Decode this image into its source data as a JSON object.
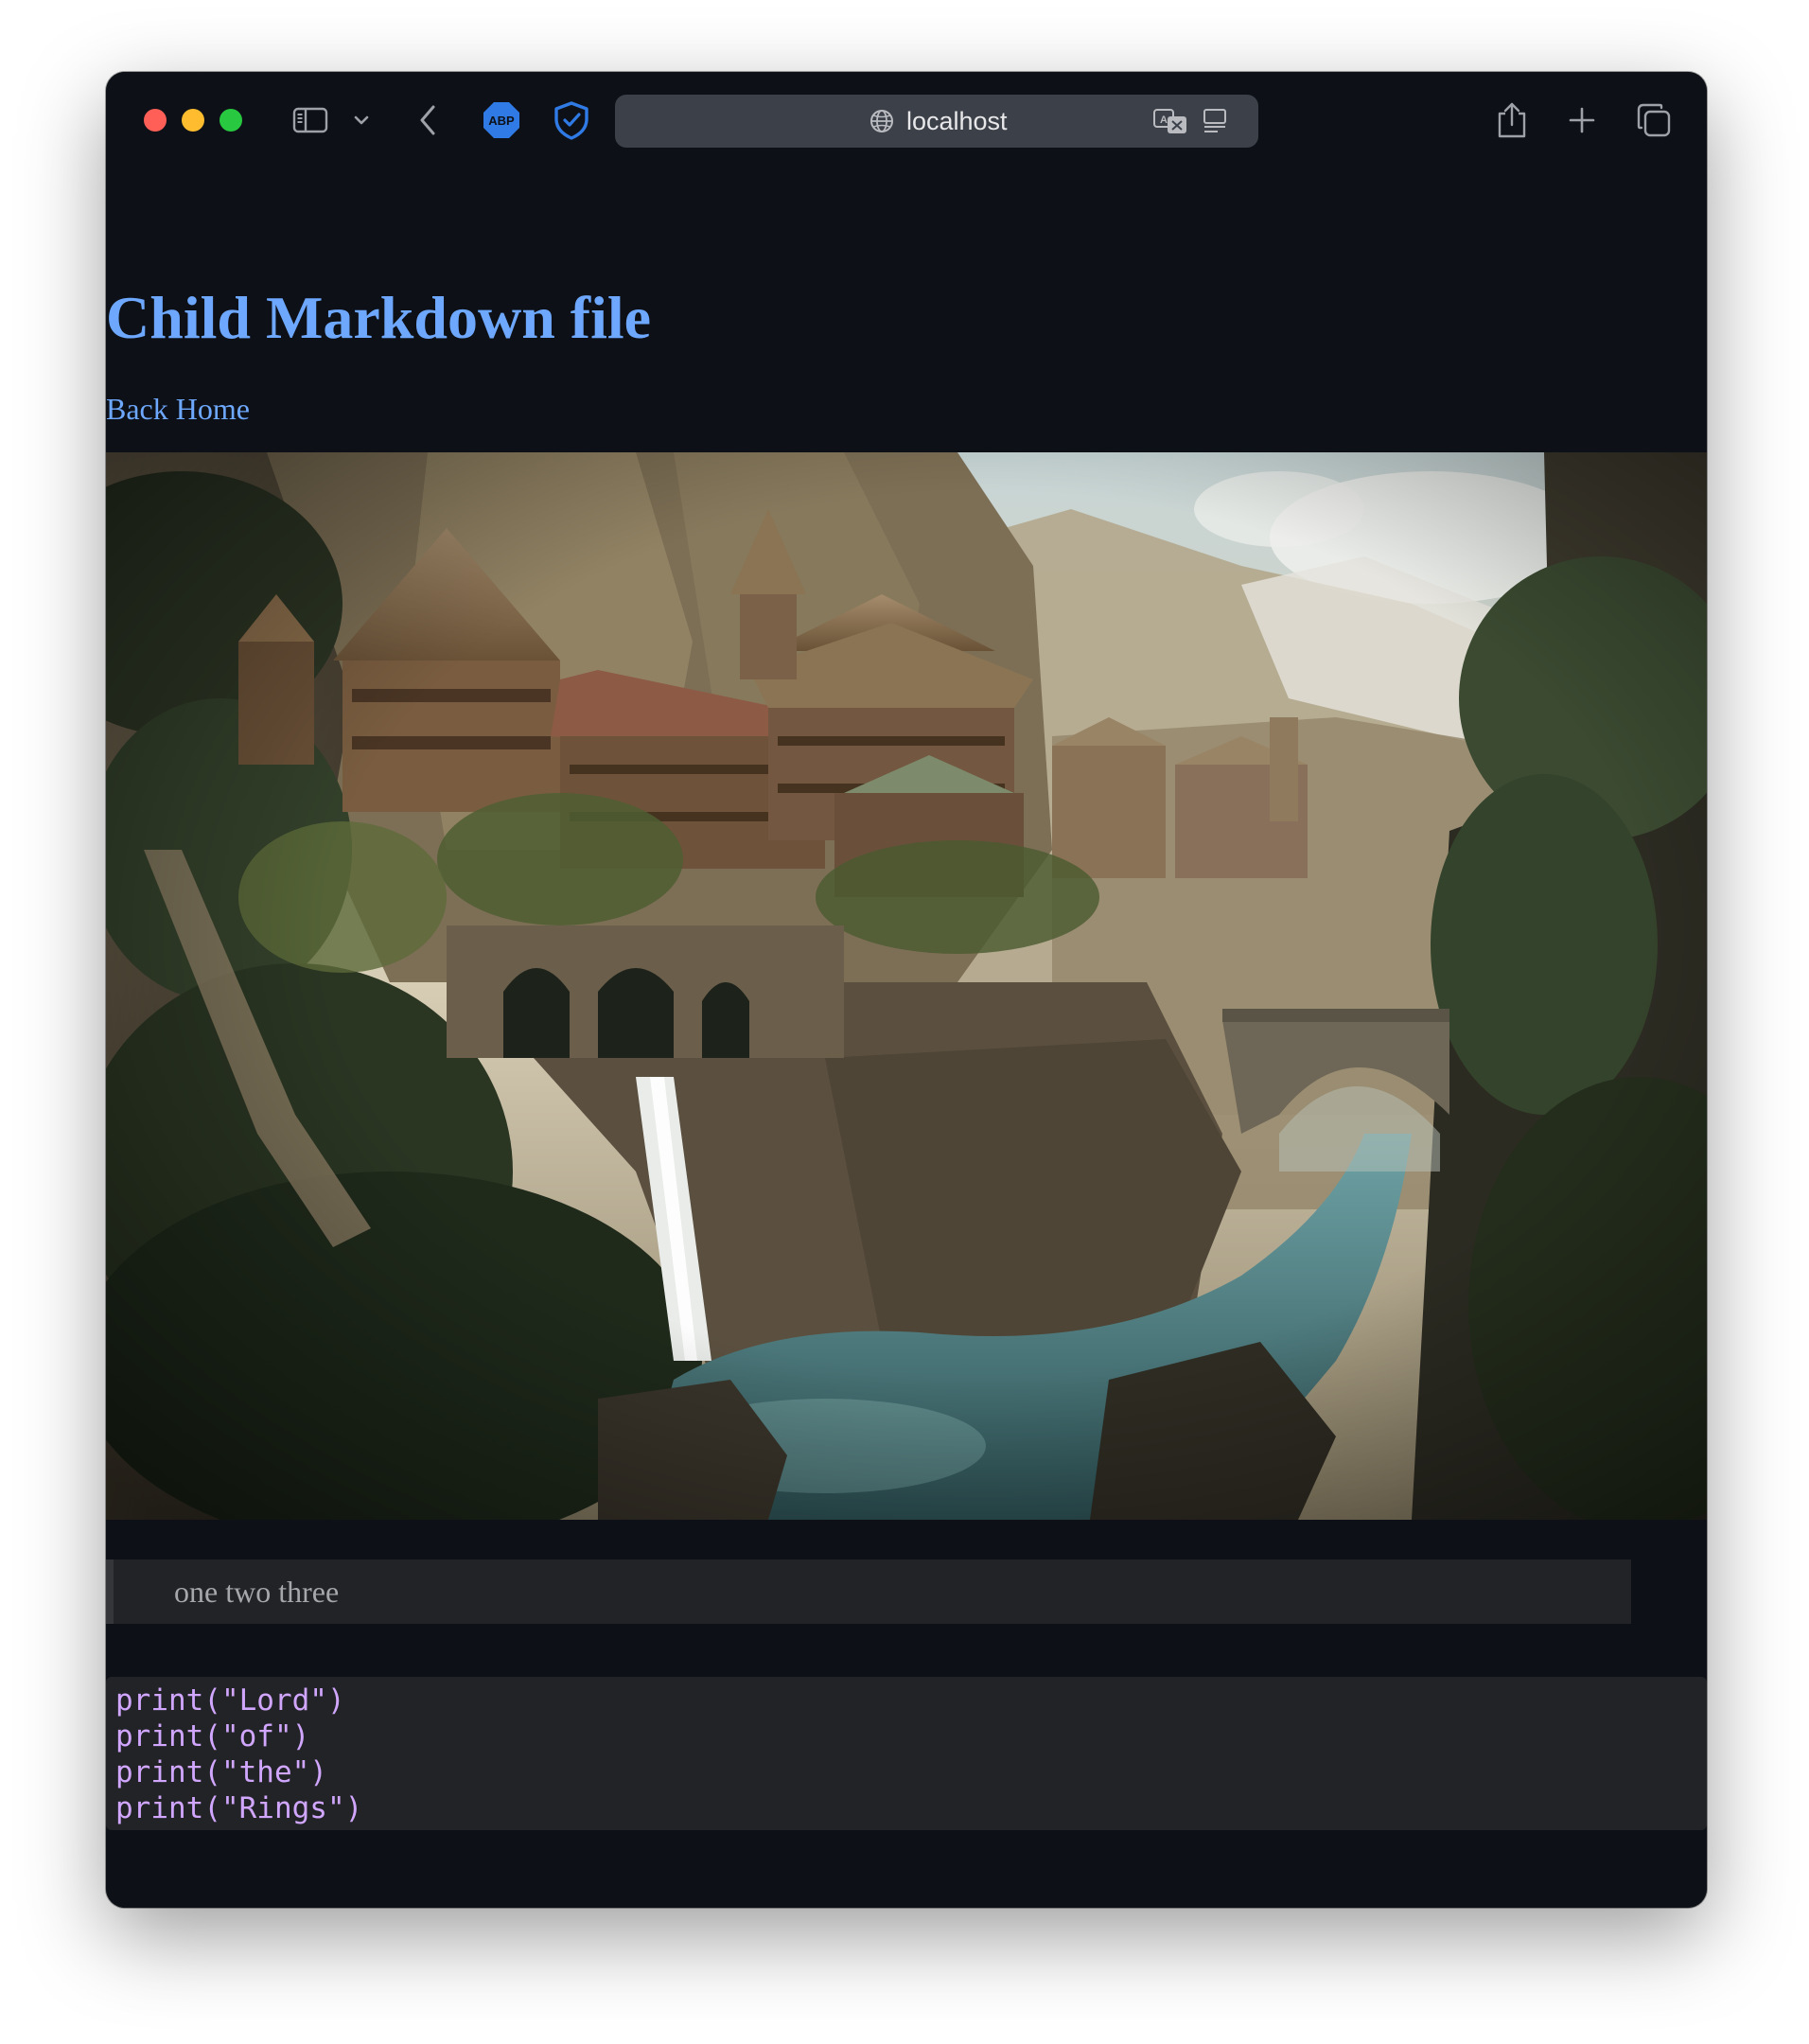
{
  "browser": {
    "url": "localhost",
    "abp_badge": "ABP"
  },
  "page": {
    "title": "Child Markdown file",
    "back_link": "Back Home",
    "blockquote": "one two three",
    "code_lines": [
      "print(\"Lord\")",
      "print(\"of\")",
      "print(\"the\")",
      "print(\"Rings\")"
    ]
  },
  "icons": [
    "sidebar-icon",
    "chevron-down-icon",
    "back-arrow-icon",
    "adblock-plus-icon",
    "shield-check-icon",
    "globe-icon",
    "translate-icon",
    "reader-icon",
    "share-icon",
    "plus-icon",
    "tabs-overview-icon"
  ],
  "colors": {
    "page_background": "#0d1117",
    "link_blue": "#6ea8fe",
    "code_text": "#d1a6ff",
    "code_background": "#222326",
    "urlbar_background": "#3c4048",
    "abp_blue": "#2f7ae5"
  }
}
